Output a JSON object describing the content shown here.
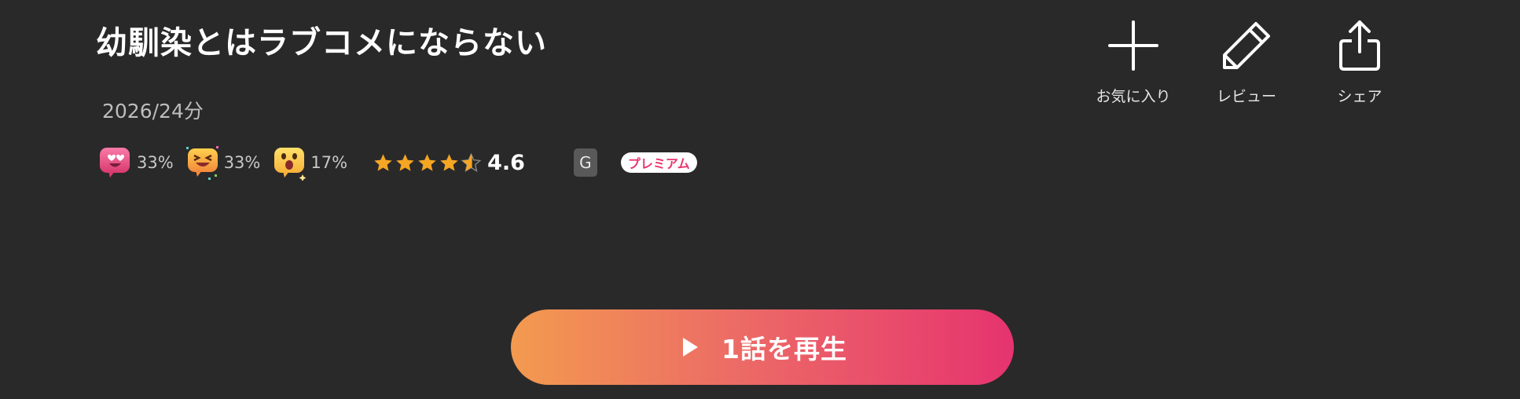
{
  "header": {
    "title": "幼馴染とはラブコメにならない",
    "meta": "2026/24分"
  },
  "reactions": [
    {
      "icon": "heart-eyes-emoji-icon",
      "percent": "33%"
    },
    {
      "icon": "laughing-party-emoji-icon",
      "percent": "33%"
    },
    {
      "icon": "surprised-emoji-icon",
      "percent": "17%"
    }
  ],
  "rating": {
    "value": "4.6",
    "stars_filled": 4.6,
    "stars_max": 5,
    "star_color": "#f5a623"
  },
  "badges": {
    "age_rating": "G",
    "premium": "プレミアム"
  },
  "actions": [
    {
      "icon": "plus-icon",
      "label": "お気に入り"
    },
    {
      "icon": "pencil-icon",
      "label": "レビュー"
    },
    {
      "icon": "share-icon",
      "label": "シェア"
    }
  ],
  "play_button": {
    "icon": "play-icon",
    "label": "1話を再生",
    "gradient_start": "#f39a4f",
    "gradient_end": "#e6336f"
  }
}
